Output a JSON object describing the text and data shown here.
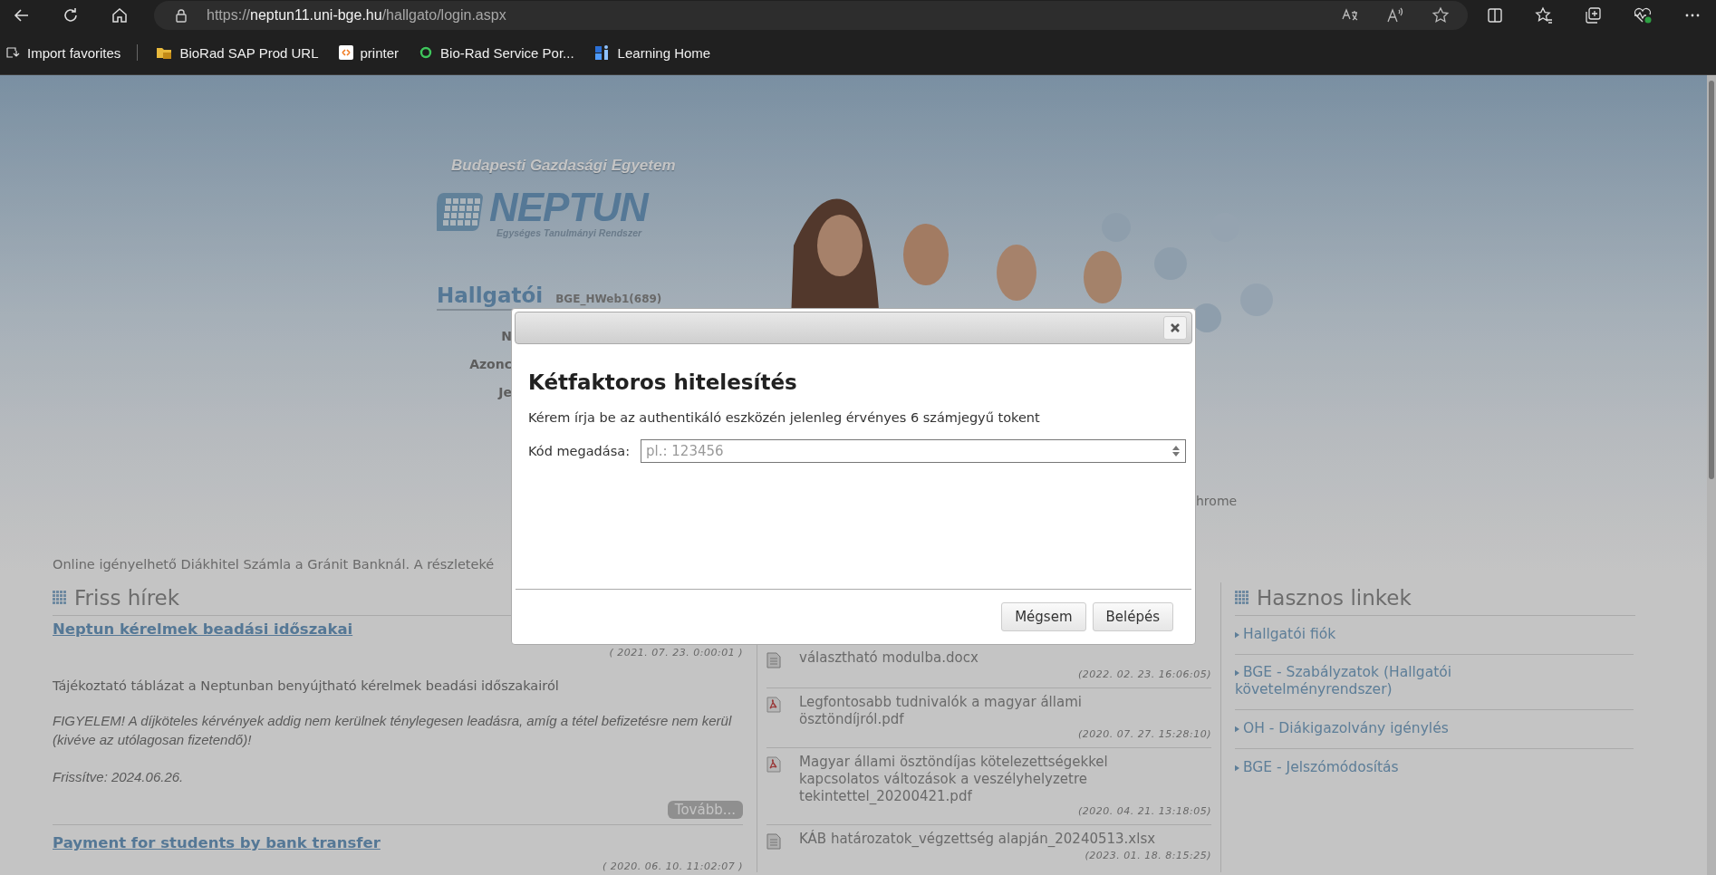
{
  "browser": {
    "address": {
      "scheme": "https://",
      "host": "neptun11.uni-bge.hu",
      "path": "/hallgato/login.aspx"
    },
    "bookmarks": [
      {
        "label": "Import favorites",
        "kind": "import"
      },
      {
        "label": "BioRad SAP Prod URL",
        "kind": "folder"
      },
      {
        "label": "printer",
        "kind": "printer"
      },
      {
        "label": "Bio-Rad Service Por...",
        "kind": "service"
      },
      {
        "label": "Learning Home",
        "kind": "learning"
      }
    ]
  },
  "header": {
    "university": "Budapesti Gazdasági Egyetem",
    "logo_title": "NEPTUN",
    "logo_subtitle": "Egységes Tanulmányi Rendszer",
    "section_title": "Hallgatói",
    "server": "BGE_HWeb1(689)",
    "login_labels": [
      "N",
      "Azonc",
      "Je"
    ],
    "browser_note": "hrome"
  },
  "notice": "Online igényelhető Diákhitel Számla a Gránit Banknál. A részleteké",
  "news": {
    "title": "Friss hírek",
    "items": [
      {
        "title": "Neptun kérelmek beadási időszakai",
        "date": "( 2021. 07. 23. 0:00:01 )",
        "body": [
          {
            "kind": "plain",
            "text": "Tájékoztató táblázat a Neptunban benyújtható kérelmek beadási időszakairól"
          },
          {
            "kind": "italic",
            "text": "FIGYELEM! A díjköteles kérvények addig nem kerülnek ténylegesen leadásra, amíg a tétel befizetésre nem kerül (kivéve az utólagosan fizetendő)!"
          },
          {
            "kind": "italic",
            "text": "Frissítve: 2024.06.26."
          }
        ],
        "more": "Tovább..."
      },
      {
        "title": "Payment for students by bank transfer",
        "date": "( 2020. 06. 10. 11:02:07 )"
      }
    ]
  },
  "documents": {
    "items": [
      {
        "kind": "docx",
        "title": "választható modulba.docx",
        "date": "(2022. 02. 23. 16:06:05)"
      },
      {
        "kind": "pdf",
        "title": "Legfontosabb tudnivalók a magyar állami ösztöndíjról.pdf",
        "date": "(2020. 07. 27. 15:28:10)"
      },
      {
        "kind": "pdf",
        "title": "Magyar állami ösztöndíjas kötelezettségekkel kapcsolatos változások a veszélyhelyzetre tekintettel_20200421.pdf",
        "date": "(2020. 04. 21. 13:18:05)"
      },
      {
        "kind": "xlsx",
        "title": "KÁB határozatok_végzettség alapján_20240513.xlsx",
        "date": "(2023. 01. 18. 8:15:25)"
      }
    ]
  },
  "links": {
    "title": "Hasznos linkek",
    "items": [
      "Hallgatói fiók",
      "BGE - Szabályzatok (Hallgatói követelményrendszer)",
      "OH - Diákigazolvány igénylés",
      "BGE - Jelszómódosítás"
    ]
  },
  "dialog": {
    "title": "Kétfaktoros hitelesítés",
    "message": "Kérem írja be az authentikáló eszközén jelenleg érvényes 6 számjegyű tokent",
    "field_label": "Kód megadása:",
    "placeholder": "pl.: 123456",
    "buttons": [
      "Mégsem",
      "Belépés"
    ]
  }
}
